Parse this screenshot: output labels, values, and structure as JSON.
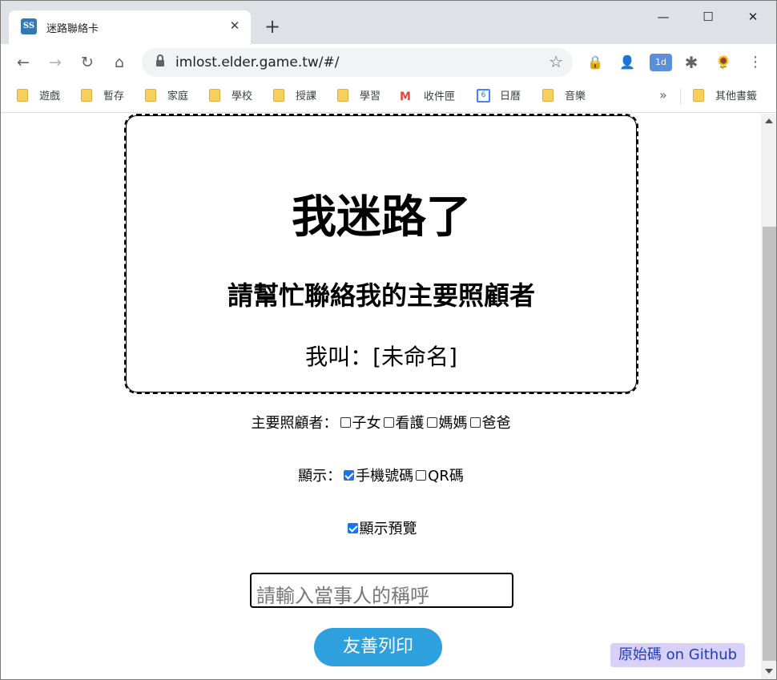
{
  "browser": {
    "tab_title": "迷路聯絡卡",
    "favicon_text": "SS",
    "tab_close": "✕",
    "new_tab": "+",
    "url": "imlost.elder.game.tw/#/",
    "window_controls": {
      "minimize": "—",
      "maximize": "☐",
      "close": "✕"
    },
    "nav": {
      "back": "←",
      "forward": "→",
      "reload": "↻",
      "home": "⌂"
    },
    "star": "☆",
    "extensions": [
      "🔒",
      "👤",
      "1d",
      "✱",
      "🌻",
      "⋮"
    ],
    "bookmarks": [
      {
        "label": "遊戲",
        "icon": "folder-icon"
      },
      {
        "label": "暫存",
        "icon": "folder-icon"
      },
      {
        "label": "家庭",
        "icon": "folder-icon"
      },
      {
        "label": "學校",
        "icon": "folder-icon"
      },
      {
        "label": "授課",
        "icon": "folder-icon"
      },
      {
        "label": "學習",
        "icon": "folder-icon"
      },
      {
        "label": "收件匣",
        "icon": "gmail-icon"
      },
      {
        "label": "日曆",
        "icon": "calendar-icon"
      },
      {
        "label": "音樂",
        "icon": "folder-icon"
      }
    ],
    "bookmarks_more": "»",
    "other_bookmarks": "其他書籤",
    "calendar_day": "6",
    "gmail_glyph": "M"
  },
  "card": {
    "title": "我迷路了",
    "subtitle": "請幫忙聯絡我的主要照顧者",
    "name_line": "我叫：[未命名]"
  },
  "caregiver": {
    "label": "主要照顧者：",
    "options": [
      {
        "label": "子女",
        "checked": false
      },
      {
        "label": "看護",
        "checked": false
      },
      {
        "label": "媽媽",
        "checked": false
      },
      {
        "label": "爸爸",
        "checked": false
      }
    ]
  },
  "display": {
    "label": "顯示：",
    "options": [
      {
        "label": "手機號碼",
        "checked": true
      },
      {
        "label": "QR碼",
        "checked": false
      }
    ]
  },
  "preview": {
    "label": "顯示預覽",
    "checked": true
  },
  "name_input": {
    "placeholder": "請輸入當事人的稱呼",
    "value": ""
  },
  "print_button": "友善列印",
  "github_link": "原始碼 on Github"
}
